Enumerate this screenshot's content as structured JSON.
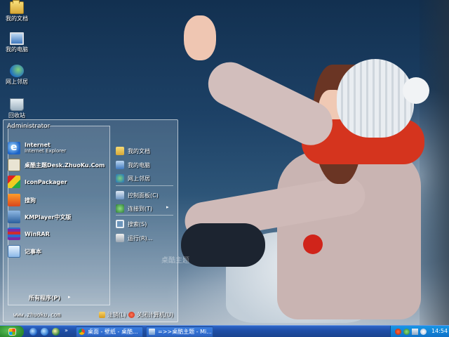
{
  "desktop": {
    "icons": [
      {
        "label": "我的文档",
        "icon": "folder-icon"
      },
      {
        "label": "我的电脑",
        "icon": "computer-icon"
      },
      {
        "label": "网上邻居",
        "icon": "network-icon"
      },
      {
        "label": "回收站",
        "icon": "recycle-bin-icon"
      }
    ],
    "wallpaper_watermark": "桌酷主题"
  },
  "start_menu": {
    "user_name": "Administrator",
    "programs": [
      {
        "label": "Internet",
        "sublabel": "Internet Explorer",
        "icon": "ie-icon"
      },
      {
        "label": "桌酷主题Desk.ZhuoKu.Com",
        "icon": "theme-icon"
      },
      {
        "label": "IconPackager",
        "icon": "iconpackager-icon"
      },
      {
        "label": "搜狗",
        "icon": "sogou-icon"
      },
      {
        "label": "KMPlayer中文版",
        "icon": "kmplayer-icon"
      },
      {
        "label": "WinRAR",
        "icon": "winrar-icon"
      },
      {
        "label": "记事本",
        "icon": "notepad-icon"
      }
    ],
    "all_programs_label": "所有程序(P)",
    "all_programs_arrow": "▸",
    "places": [
      {
        "label": "我的文档",
        "icon": "folder-icon"
      },
      {
        "label": "我的电脑",
        "icon": "computer-icon"
      },
      {
        "label": "网上邻居",
        "icon": "network-icon"
      },
      {
        "label": "控制面板(C)",
        "icon": "control-panel-icon"
      },
      {
        "label": "连接到(T)",
        "icon": "connect-icon"
      },
      {
        "label": "搜索(S)",
        "icon": "search-icon"
      },
      {
        "label": "运行(R)...",
        "icon": "run-icon"
      }
    ],
    "connect_arrow": "▸",
    "website": "www.zhuoku.com",
    "logoff_label": "注销(L)",
    "shutdown_label": "关闭计算机(U)"
  },
  "taskbar": {
    "quick_launch_more": "»",
    "tasks": [
      {
        "label": "桌面 - 壁纸 - 桌酷...",
        "icon": "chrome-icon"
      },
      {
        "label": "=>>桌酷主题 - Mi...",
        "icon": "document-icon"
      }
    ],
    "clock": "14:54"
  },
  "colors": {
    "taskbar": "#1f4fa8",
    "start_button": "#2a8a2e",
    "systray": "#0f6fc6"
  }
}
